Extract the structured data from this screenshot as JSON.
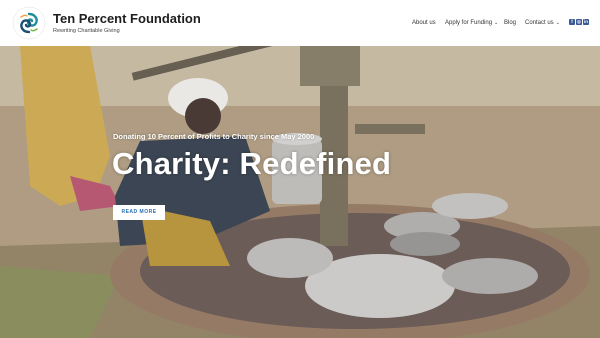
{
  "brand": {
    "title": "Ten Percent Foundation",
    "tagline": "Rewriting Charitable Giving",
    "logo_text_top": "TEN PERCENT",
    "logo_text_bottom": "FOUNDATION"
  },
  "nav": {
    "items": [
      {
        "label": "About us",
        "dropdown": false
      },
      {
        "label": "Apply for Funding",
        "dropdown": true
      },
      {
        "label": "Blog",
        "dropdown": false
      },
      {
        "label": "Contact us",
        "dropdown": true
      }
    ],
    "socials": [
      {
        "icon": "facebook-icon",
        "glyph": "f"
      },
      {
        "icon": "instagram-icon",
        "glyph": "◎"
      },
      {
        "icon": "linkedin-icon",
        "glyph": "in"
      }
    ]
  },
  "hero": {
    "subtitle": "Donating 10 Percent of Profits to Charity since May 2000",
    "title": "Charity: Redefined",
    "button_label": "READ MORE"
  },
  "colors": {
    "brand_teal": "#1a8f9a",
    "button_text": "#2c6fb2",
    "social": "#3b5998"
  }
}
